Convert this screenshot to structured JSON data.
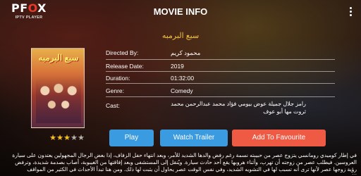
{
  "app": {
    "logo_main": "PF",
    "logo_o": "O",
    "logo_x": "X",
    "logo_sub": "IPTV PLAYER",
    "screen_title": "MOVIE INFO",
    "menu_icon": "more-vert-icon"
  },
  "movie": {
    "title": "سبع البرمبه",
    "poster_title": "سبع البرمبه",
    "rating": 3,
    "rating_max": 5,
    "stars": [
      "★",
      "★",
      "★",
      "★",
      "★"
    ]
  },
  "details": {
    "directed_by_label": "Directed By:",
    "directed_by": "محمود كريم",
    "release_label": "Release Date:",
    "release": "2019",
    "duration_label": "Duration:",
    "duration": "01:32:00",
    "genre_label": "Genre:",
    "genre": "Comedy",
    "cast_label": "Cast:",
    "cast": "رامز جلال جميلة عوض بيومي فؤاد محمد عبدالرحمن محمد ثروت مها أبو عوف"
  },
  "buttons": {
    "play": "Play",
    "trailer": "Watch Trailer",
    "favourite": "Add To Favourite"
  },
  "description": "في إطار كوميدي رومانسي يتزوج عصر من حبيبته نسمة رغم رفض والدها الشديد للأمر، وبعد انتهاء حفل الزفاف، إذا بعض الرجال المجهولين يعتدون على سيارة العروسين. فيطلب عصر من زوجته أن تهرب، وأثناء هروبها يقع أحد حادث سيارة. ويُنقل إلى المستشفى وبعد إفاقتها من الغيبوبة، أصاب بصدمة شديدة، وترفض رؤية زوجها عصر لأنها ترى أنه تسبب لها في التشويه الشديد، وفي نفس الوقت عصر يحاول أن يثبت لها ذلك. ومن هنا تبدأ الأحداث في الكثير من المواقف الكوميدية."
}
